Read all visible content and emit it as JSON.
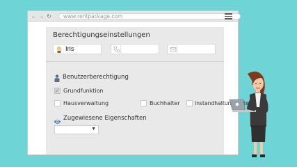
{
  "browser": {
    "url": "www.rentpackage.com",
    "nav_icons": [
      "back-icon",
      "forward-icon",
      "reload-icon"
    ],
    "menu_icon": "hamburger-menu-icon"
  },
  "panel": {
    "title": "Berechtigungseinstellungen",
    "fields": {
      "name": {
        "value": "Iris",
        "icon": "user-avatar-icon"
      },
      "phone": {
        "value": "",
        "icon": "phone-icon"
      },
      "email": {
        "value": "",
        "icon": "mail-icon"
      }
    },
    "user_permissions": {
      "heading": "Benutzerberechtigung",
      "icon": "user-icon",
      "base_function": {
        "label": "Grundfunktion",
        "checked": true
      },
      "options": [
        {
          "label": "Hausverwaltung",
          "checked": false
        },
        {
          "label": "Buchhalter",
          "checked": false
        },
        {
          "label": "Instandhaltungsleiter",
          "checked": false
        }
      ]
    },
    "assigned_properties": {
      "heading": "Zugewiesene Eigenschaften",
      "icon": "eye-icon",
      "selected": "",
      "arrow": "▼"
    }
  },
  "colors": {
    "background": "#6fd4d6",
    "panel": "#e9e9e9",
    "accent": "#4a77b4"
  }
}
